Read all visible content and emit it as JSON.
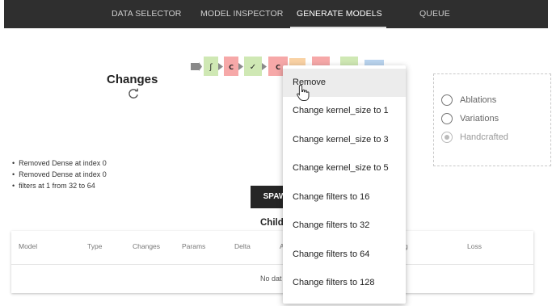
{
  "nav": {
    "tabs": [
      {
        "label": "DATA SELECTOR",
        "active": false
      },
      {
        "label": "MODEL INSPECTOR",
        "active": false
      },
      {
        "label": "GENERATE MODELS",
        "active": true
      },
      {
        "label": "QUEUE",
        "active": false
      }
    ]
  },
  "changes": {
    "title": "Changes",
    "refresh_icon": "refresh-icon",
    "items": [
      "Removed Dense at index 0",
      "Removed Dense at index 0",
      "filters at 1 from 32 to 64"
    ]
  },
  "pipeline": {
    "blocks": [
      {
        "label": "",
        "color": "#8a8a8a"
      },
      {
        "label": "∫",
        "color": "#cfe8b4"
      },
      {
        "label": "C",
        "color": "#f6a8a8"
      },
      {
        "label": "✓",
        "color": "#cfe8b4"
      },
      {
        "label": "C",
        "color": "#f6a8a8"
      }
    ]
  },
  "spawn": {
    "label": "SPAW"
  },
  "children": {
    "title": "Child",
    "columns": [
      "Model",
      "Type",
      "Changes",
      "Params",
      "Delta",
      "A",
      "g",
      "Loss"
    ],
    "empty_text": "No dat"
  },
  "options": {
    "items": [
      {
        "label": "Ablations",
        "checked": false,
        "disabled": false
      },
      {
        "label": "Variations",
        "checked": false,
        "disabled": false
      },
      {
        "label": "Handcrafted",
        "checked": true,
        "disabled": true
      }
    ]
  },
  "context_menu": {
    "items": [
      "Remove",
      "Change kernel_size to 1",
      "Change kernel_size to 3",
      "Change kernel_size to 5",
      "Change filters to 16",
      "Change filters to 32",
      "Change filters to 64",
      "Change filters to 128"
    ],
    "hovered_index": 0
  },
  "colors": {
    "topbar": "#2f2f2f",
    "conv_block": "#f6a8a8",
    "act_block": "#cfe8b4",
    "orange_block": "#f9d2a4",
    "blue_block": "#b9d3ee",
    "spawn_button": "#262626"
  }
}
